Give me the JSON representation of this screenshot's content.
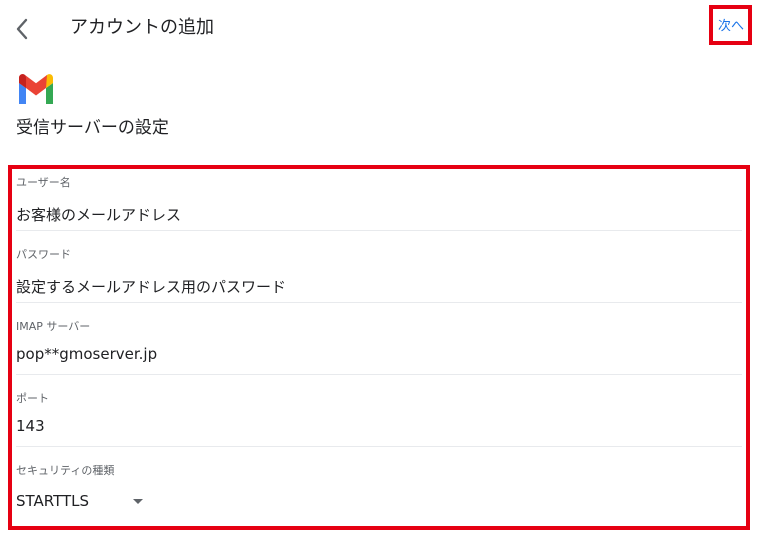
{
  "header": {
    "back_icon": "chevron-left-icon",
    "title": "アカウントの追加",
    "next_label": "次へ"
  },
  "logo_icon": "gmail-logo",
  "section_title": "受信サーバーの設定",
  "fields": {
    "username": {
      "label": "ユーザー名",
      "value": "お客様のメールアドレス"
    },
    "password": {
      "label": "パスワード",
      "value": "設定するメールアドレス用のパスワード"
    },
    "imap_server": {
      "label": "IMAP サーバー",
      "value": "pop**gmoserver.jp"
    },
    "port": {
      "label": "ポート",
      "value": "143"
    },
    "security": {
      "label": "セキュリティの種類",
      "value": "STARTTLS"
    }
  },
  "colors": {
    "highlight": "#e60012",
    "link": "#1a73e8",
    "gmail_red": "#ea4335",
    "gmail_blue": "#4285f4",
    "gmail_green": "#34a853",
    "gmail_yellow": "#fbbc04"
  }
}
